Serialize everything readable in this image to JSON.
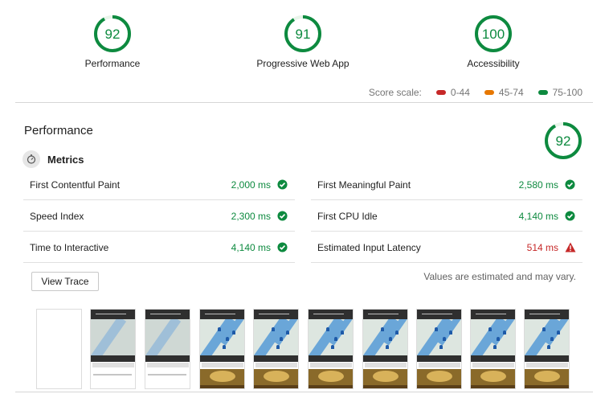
{
  "colors": {
    "pass": "#0d8a3f",
    "average": "#e67700",
    "fail": "#c62828"
  },
  "summary": [
    {
      "score": "92",
      "label": "Performance",
      "fraction": 0.92
    },
    {
      "score": "91",
      "label": "Progressive Web App",
      "fraction": 0.91
    },
    {
      "score": "100",
      "label": "Accessibility",
      "fraction": 1.0
    }
  ],
  "score_scale": {
    "label": "Score scale:",
    "ranges": [
      {
        "label": "0-44",
        "color": "#c62828"
      },
      {
        "label": "45-74",
        "color": "#e67700"
      },
      {
        "label": "75-100",
        "color": "#0d8a3f"
      }
    ]
  },
  "performance": {
    "title": "Performance",
    "score": "92",
    "fraction": 0.92,
    "metrics_title": "Metrics",
    "metrics_icon": "stopwatch-icon",
    "metrics": [
      {
        "name": "First Contentful Paint",
        "value": "2,000 ms",
        "status": "pass",
        "icon": "check-circle-icon"
      },
      {
        "name": "First Meaningful Paint",
        "value": "2,580 ms",
        "status": "pass",
        "icon": "check-circle-icon"
      },
      {
        "name": "Speed Index",
        "value": "2,300 ms",
        "status": "pass",
        "icon": "check-circle-icon"
      },
      {
        "name": "First CPU Idle",
        "value": "4,140 ms",
        "status": "pass",
        "icon": "check-circle-icon"
      },
      {
        "name": "Time to Interactive",
        "value": "4,140 ms",
        "status": "pass",
        "icon": "check-circle-icon"
      },
      {
        "name": "Estimated Input Latency",
        "value": "514 ms",
        "status": "fail",
        "icon": "warning-triangle-icon"
      }
    ],
    "view_trace_label": "View Trace",
    "note": "Values are estimated and may vary.",
    "filmstrip": [
      "blank",
      "map-loading",
      "map-loading",
      "map-full",
      "map-full",
      "map-full",
      "map-full",
      "map-full",
      "map-full",
      "map-full"
    ]
  }
}
